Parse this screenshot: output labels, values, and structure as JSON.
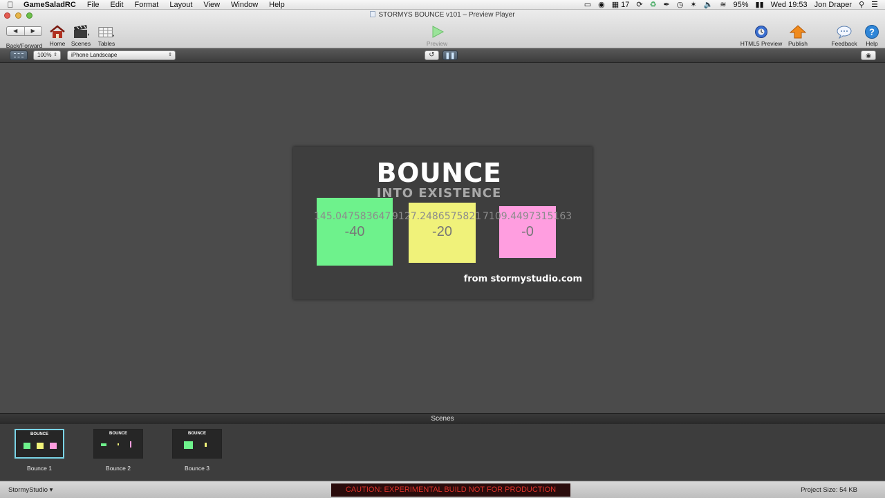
{
  "menubar": {
    "app_name": "GameSaladRC",
    "items": [
      "File",
      "Edit",
      "Format",
      "Layout",
      "View",
      "Window",
      "Help"
    ],
    "status": {
      "calendar_date": "17",
      "battery": "95%",
      "clock": "Wed 19:53",
      "user": "Jon Draper"
    }
  },
  "window": {
    "title": "STORMYS BOUNCE v101 – Preview Player"
  },
  "toolbar": {
    "back_forward_label": "Back/Forward",
    "home_label": "Home",
    "scenes_label": "Scenes",
    "tables_label": "Tables",
    "preview_label": "Preview",
    "html5_preview_label": "HTML5 Preview",
    "publish_label": "Publish",
    "feedback_label": "Feedback",
    "help_label": "Help"
  },
  "subbar": {
    "zoom_value": "100%",
    "device_value": "iPhone Landscape"
  },
  "stage": {
    "title": "BOUNCE",
    "subtitle": "INTO EXISTENCE",
    "boxes": [
      {
        "color": "#6ef28c",
        "value": "-40",
        "readout": "145.047583647"
      },
      {
        "color": "#f0f27a",
        "value": "-20",
        "readout": "9127.2486575821"
      },
      {
        "color": "#ff9ee0",
        "value": "-0",
        "readout": "7109.4497315163"
      }
    ],
    "credit": "from stormystudio.com"
  },
  "scenes": {
    "header": "Scenes",
    "items": [
      {
        "label": "Bounce 1",
        "thumb_title": "BOUNCE"
      },
      {
        "label": "Bounce 2",
        "thumb_title": "BOUNCE"
      },
      {
        "label": "Bounce 3",
        "thumb_title": "BOUNCE"
      }
    ]
  },
  "statusbar": {
    "account": "StormyStudio",
    "caution": "CAUTION: EXPERIMENTAL BUILD NOT FOR PRODUCTION",
    "project_size": "Project Size: 54 KB"
  }
}
